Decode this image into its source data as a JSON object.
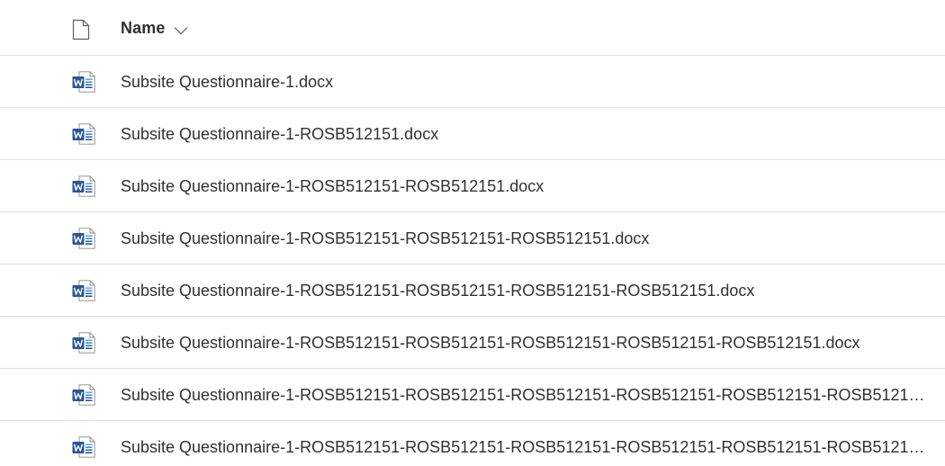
{
  "header": {
    "name_label": "Name",
    "file_type_icon": "document-outline-icon",
    "sort_icon": "chevron-down-icon"
  },
  "colors": {
    "word_blue": "#2b579a",
    "word_light": "#41a5ee",
    "divider": "#e1dfdd",
    "text": "#323130"
  },
  "files": [
    {
      "name": "Subsite Questionnaire-1.docx",
      "icon": "word-document-icon"
    },
    {
      "name": "Subsite Questionnaire-1-ROSB512151.docx",
      "icon": "word-document-icon"
    },
    {
      "name": "Subsite Questionnaire-1-ROSB512151-ROSB512151.docx",
      "icon": "word-document-icon"
    },
    {
      "name": "Subsite Questionnaire-1-ROSB512151-ROSB512151-ROSB512151.docx",
      "icon": "word-document-icon"
    },
    {
      "name": "Subsite Questionnaire-1-ROSB512151-ROSB512151-ROSB512151-ROSB512151.docx",
      "icon": "word-document-icon"
    },
    {
      "name": "Subsite Questionnaire-1-ROSB512151-ROSB512151-ROSB512151-ROSB512151-ROSB512151.docx",
      "icon": "word-document-icon"
    },
    {
      "name": "Subsite Questionnaire-1-ROSB512151-ROSB512151-ROSB512151-ROSB512151-ROSB512151-ROSB51215...",
      "icon": "word-document-icon"
    },
    {
      "name": "Subsite Questionnaire-1-ROSB512151-ROSB512151-ROSB512151-ROSB512151-ROSB512151-ROSB51215...",
      "icon": "word-document-icon"
    }
  ]
}
